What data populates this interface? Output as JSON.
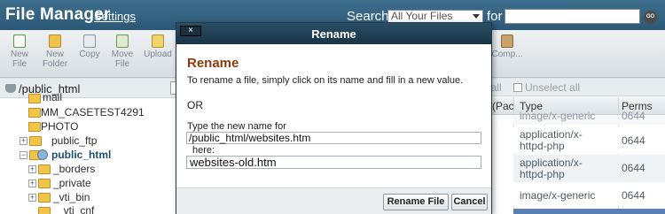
{
  "header": {
    "title": "File Manager",
    "settings_label": "Settings",
    "search_label": "Search",
    "search_scope": "All Your Files",
    "for_label": "for",
    "search_value": "",
    "go_label": "GO"
  },
  "toolbar": {
    "new_file_line1": "New",
    "new_file_line2": "File",
    "new_folder_line1": "New",
    "new_folder_line2": "Folder",
    "copy_label": "Copy",
    "move_file_line1": "Move",
    "move_file_line2": "File",
    "upload_label": "Upload",
    "compress_label": "Comp..."
  },
  "tree": {
    "path": "/public_html",
    "items": [
      {
        "label": "mail"
      },
      {
        "label": "MM_CASETEST4291"
      },
      {
        "label": "PHOTO"
      },
      {
        "label": "public_ftp"
      },
      {
        "label": "public_html"
      },
      {
        "label": "_borders"
      },
      {
        "label": "_private"
      },
      {
        "label": "_vti_bin"
      },
      {
        "label": "_vti_cnf"
      }
    ]
  },
  "listing": {
    "select_all_label": "t all",
    "unselect_all_label": "Unselect all",
    "col_pac": "(Pac",
    "col_type": "Type",
    "col_perms": "Perms",
    "rows": [
      {
        "type": "image/x-generic",
        "perms": "0644"
      },
      {
        "type_line1": "application/x-",
        "type_line2": "httpd-php",
        "perms": "0644"
      },
      {
        "type_line1": "application/x-",
        "type_line2": "httpd-php",
        "perms": "0644"
      },
      {
        "type": "image/x-generic",
        "perms": "0644"
      }
    ]
  },
  "dialog": {
    "close_label": "×",
    "title": "Rename",
    "heading": "Rename",
    "instructions": "To rename a file, simply click on its name and fill in a new value.",
    "or_label": "OR",
    "type_label": "Type the new name for",
    "current_path": "/public_html/websites.htm",
    "here_label": "here:",
    "new_name": "websites-old.htm",
    "rename_button": "Rename File",
    "cancel_button": "Cancel"
  }
}
